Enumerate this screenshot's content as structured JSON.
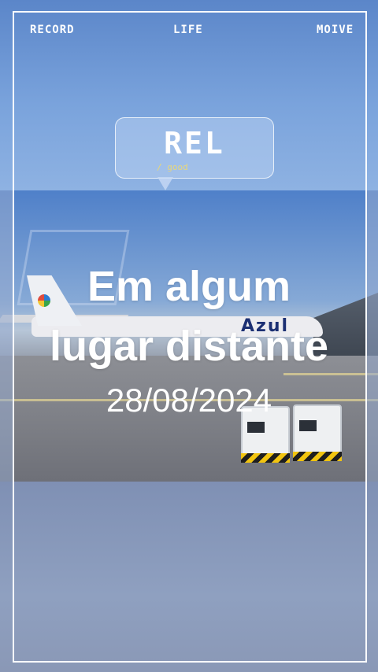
{
  "header": {
    "left_label": "RECORD",
    "center_label": "LIFE",
    "right_label": "MOIVE"
  },
  "bubble": {
    "title": "REL",
    "subtitle": "/ good"
  },
  "headline": {
    "line1": "Em algum",
    "line2": "lugar distante"
  },
  "date": "28/08/2024",
  "photo": {
    "plane_brand": "Azul"
  },
  "colors": {
    "frame": "#ffffff",
    "sky": "#5b86c9",
    "bubble_subtitle": "#e8d77a"
  }
}
